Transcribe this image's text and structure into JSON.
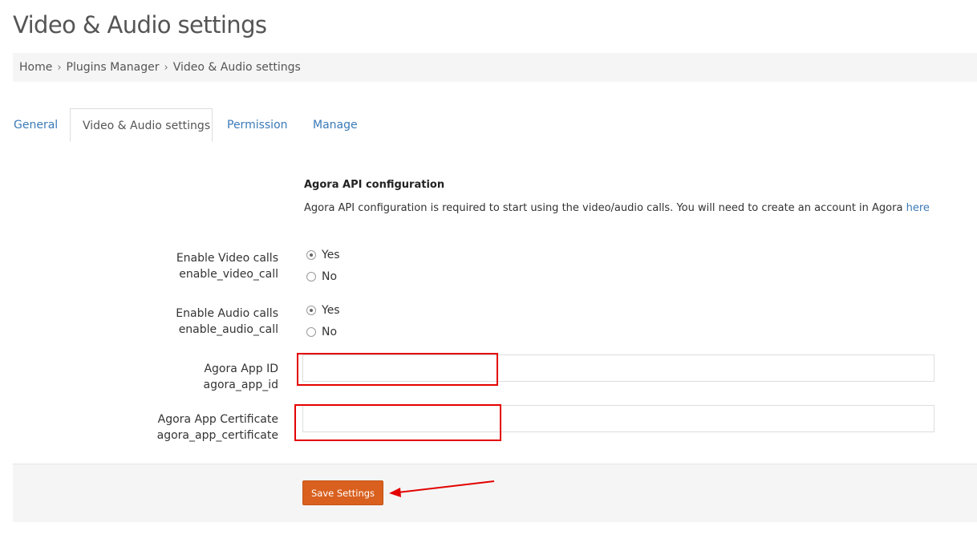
{
  "page_title": "Video & Audio settings",
  "breadcrumb": {
    "items": [
      "Home",
      "Plugins Manager",
      "Video & Audio settings"
    ],
    "separator": "›"
  },
  "tabs": [
    {
      "label": "General",
      "active": false
    },
    {
      "label": "Video & Audio settings",
      "active": true
    },
    {
      "label": "Permission",
      "active": false
    },
    {
      "label": "Manage",
      "active": false
    }
  ],
  "section": {
    "title": "Agora API configuration",
    "description": "Agora API configuration is required to start using the video/audio calls. You will need to create an account in Agora",
    "link_label": "here"
  },
  "fields": {
    "enable_video": {
      "label": "Enable Video calls",
      "key": "enable_video_call",
      "options": [
        "Yes",
        "No"
      ],
      "selected": "Yes"
    },
    "enable_audio": {
      "label": "Enable Audio calls",
      "key": "enable_audio_call",
      "options": [
        "Yes",
        "No"
      ],
      "selected": "Yes"
    },
    "app_id": {
      "label": "Agora App ID",
      "key": "agora_app_id",
      "value": ""
    },
    "app_certificate": {
      "label": "Agora App Certificate",
      "key": "agora_app_certificate",
      "value": ""
    }
  },
  "save_button_label": "Save Settings",
  "colors": {
    "link": "#3a7ab8",
    "save_button": "#d9601e",
    "annotation_red": "#e30000"
  }
}
